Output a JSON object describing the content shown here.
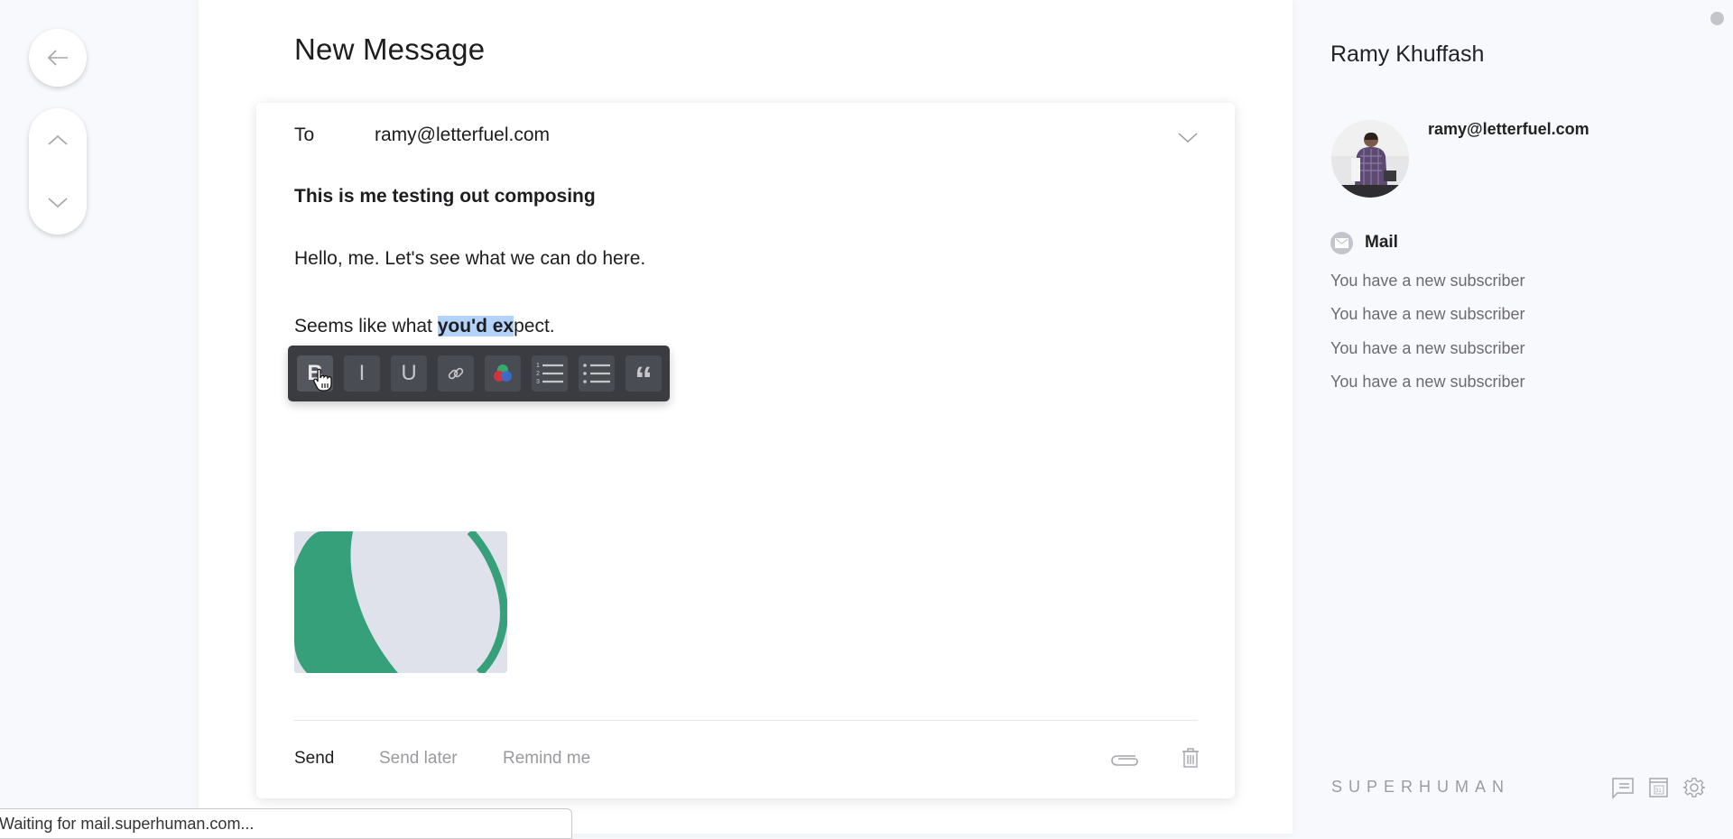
{
  "nav": {
    "back_icon": "arrow-left-icon",
    "up_icon": "chevron-up-icon",
    "down_icon": "chevron-down-icon"
  },
  "compose": {
    "title": "New Message",
    "to_label": "To",
    "to_value": "ramy@letterfuel.com",
    "subject": "This is me testing out composing",
    "body": {
      "line1": "Hello, me. Let's see what we can do here.",
      "line2_prefix": "Seems like what ",
      "line2_selected_bold": "you'd ex",
      "line2_suffix": "pect."
    },
    "toolbar": [
      {
        "name": "bold",
        "label": "B",
        "icon": "bold-icon"
      },
      {
        "name": "italic",
        "label": "I",
        "icon": "italic-icon"
      },
      {
        "name": "underline",
        "label": "U",
        "icon": "underline-icon"
      },
      {
        "name": "link",
        "label": "",
        "icon": "link-icon"
      },
      {
        "name": "color",
        "label": "",
        "icon": "color-palette-icon"
      },
      {
        "name": "numbered-list",
        "label": "",
        "icon": "numbered-list-icon"
      },
      {
        "name": "bulleted-list",
        "label": "",
        "icon": "bulleted-list-icon"
      },
      {
        "name": "quote",
        "label": "“",
        "icon": "quote-icon"
      }
    ],
    "footer": {
      "send": "Send",
      "send_later": "Send later",
      "remind_me": "Remind me"
    }
  },
  "contact": {
    "name": "Ramy Khuffash",
    "email": "ramy@letterfuel.com",
    "section_label": "Mail",
    "recent": [
      "You have a new subscriber",
      "You have a new subscriber",
      "You have a new subscriber",
      "You have a new subscriber"
    ]
  },
  "brand": "SUPERHUMAN",
  "colors": {
    "accent_green": "#35a07a",
    "selection": "#b4d3fa",
    "toolbar_bg": "#3a3c42"
  },
  "status_bar": "Waiting for mail.superhuman.com..."
}
